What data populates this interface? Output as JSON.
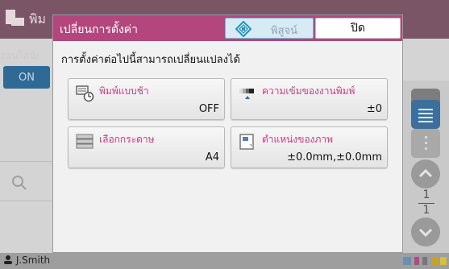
{
  "background": {
    "title": "พิม",
    "online_label": "ออนไลน์/",
    "on_label": "ON",
    "user_name": "J.Smith",
    "page_number": "1",
    "page_total": "1"
  },
  "dialog": {
    "title": "เปลี่ยนการตั้งค่า",
    "proof_label": "พิสูจน์",
    "close_label": "ปิด",
    "message": "การตั้งค่าต่อไปนี้สามารถเปลี่ยนแปลงได้"
  },
  "tiles": [
    {
      "label": "พิมพ์แบบช้า",
      "value": "OFF",
      "icon": "slow-print-icon"
    },
    {
      "label": "ความเข้มของงานพิมพ์",
      "value": "±0",
      "icon": "print-density-icon"
    },
    {
      "label": "เลือกกระดาษ",
      "value": "A4",
      "icon": "paper-tray-icon"
    },
    {
      "label": "ตำแหน่งของภาพ",
      "value": "±0.0mm,±0.0mm",
      "icon": "image-position-icon"
    }
  ],
  "colors": {
    "accent": "#b3467c",
    "tile_label": "#c23f80",
    "proof_bg": "#d8ebf5"
  }
}
